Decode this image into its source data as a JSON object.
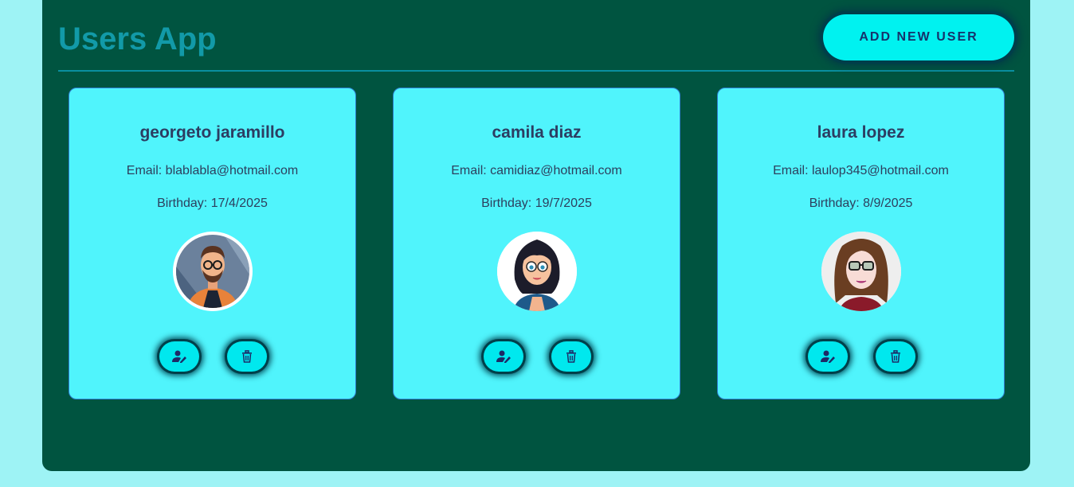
{
  "header": {
    "title": "Users App",
    "add_button_label": "ADD NEW USER"
  },
  "users": [
    {
      "name": "georgeto jaramillo",
      "email": "Email: blablabla@hotmail.com",
      "birthday": "Birthday: 17/4/2025",
      "avatar_icon": "man-with-glasses-avatar"
    },
    {
      "name": "camila diaz",
      "email": "Email: camidiaz@hotmail.com",
      "birthday": "Birthday: 19/7/2025",
      "avatar_icon": "woman-with-glasses-avatar"
    },
    {
      "name": "laura lopez",
      "email": "Email: laulop345@hotmail.com",
      "birthday": "Birthday: 8/9/2025",
      "avatar_icon": "woman-brown-hair-glasses-avatar"
    }
  ],
  "colors": {
    "page_bg": "#9ef3f5",
    "app_bg": "#005440",
    "card_bg": "#50f4fc",
    "accent": "#00f2f0",
    "title": "#129aa8",
    "text": "#2c3d62"
  },
  "actions": {
    "edit_icon": "user-edit-icon",
    "delete_icon": "trash-icon"
  }
}
